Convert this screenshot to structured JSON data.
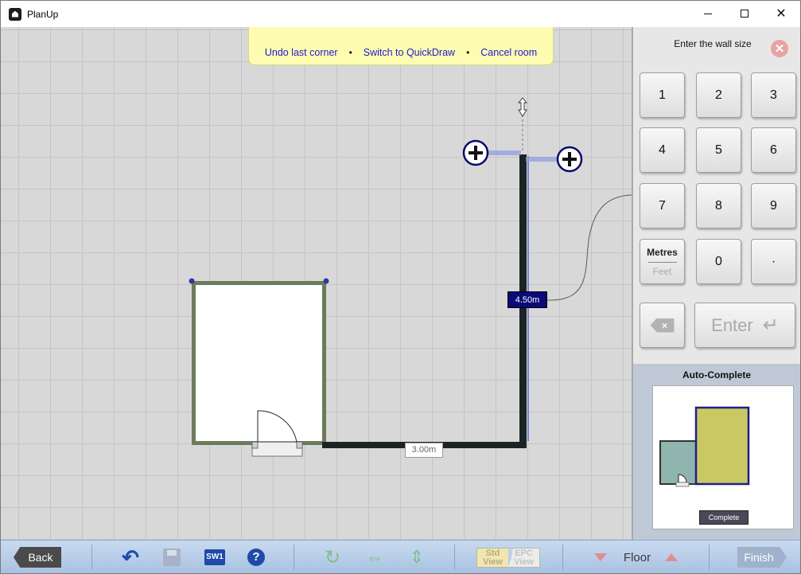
{
  "window": {
    "title": "PlanUp"
  },
  "hint_bar": {
    "undo_label": "Undo last corner",
    "quickdraw_label": "Switch to QuickDraw",
    "cancel_label": "Cancel room",
    "separator": "•"
  },
  "dimensions": {
    "active_wall": "4.50m",
    "bottom_wall": "3.00m"
  },
  "keypad": {
    "heading": "Enter the wall size",
    "keys": [
      "1",
      "2",
      "3",
      "4",
      "5",
      "6",
      "7",
      "8",
      "9"
    ],
    "zero": "0",
    "dot": "·",
    "unit_selected": "Metres",
    "unit_other": "Feet",
    "backspace_glyph": "×",
    "enter_label": "Enter",
    "enter_glyph": "↵"
  },
  "auto_complete": {
    "title": "Auto-Complete",
    "button_label": "Complete"
  },
  "toolbar": {
    "back_label": "Back",
    "sw1_label": "SW1",
    "help_glyph": "?",
    "view_std": [
      "Std",
      "View"
    ],
    "view_epc": [
      "EPC",
      "View"
    ],
    "floor_label": "Floor",
    "finish_label": "Finish"
  },
  "colors": {
    "wall_dark": "#1b2424",
    "room_wall": "#6c7b5c",
    "active_dim_bg": "#0a0a78",
    "toolbar_bg": "#b8cde8",
    "auto_room_teal": "#8fb5ae",
    "auto_room_yellow": "#c9c863"
  }
}
